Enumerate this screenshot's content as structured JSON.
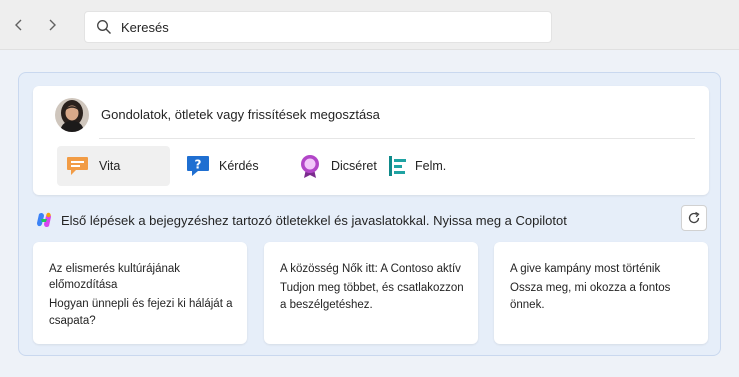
{
  "nav": {
    "back_icon": "chevron-left-icon",
    "forward_icon": "chevron-right-icon"
  },
  "search": {
    "placeholder": "Keresés",
    "icon": "search-icon"
  },
  "composer": {
    "prompt": "Gondolatok, ötletek vagy frissítések megosztása",
    "post_types": [
      {
        "label": "Vita",
        "icon": "discussion-icon",
        "color": "#e8833a"
      },
      {
        "label": "Kérdés",
        "icon": "question-icon",
        "color": "#1f6fd1"
      },
      {
        "label": "Dicséret",
        "icon": "praise-badge-icon",
        "color": "#a43ab8"
      },
      {
        "label": "Felm.",
        "icon": "poll-icon",
        "color": "#0f8a8a"
      }
    ]
  },
  "copilot": {
    "text": "Első lépések a bejegyzéshez tartozó ötletekkel és javaslatokkal. Nyissa meg a Copilotot",
    "refresh_icon": "refresh-icon"
  },
  "suggestions": [
    {
      "title": "Az elismerés kultúrájának előmozdítása",
      "desc": "Hogyan ünnepli és fejezi ki háláját a csapata?"
    },
    {
      "title": "A közösség Nők itt: A Contoso aktív",
      "desc": "Tudjon meg többet, és csatlakozzon a beszélgetéshez."
    },
    {
      "title": "A give kampány most történik",
      "desc": "Ossza meg, mi okozza a fontos önnek."
    }
  ],
  "colors": {
    "accent": "#0f6cbd",
    "feed_background": "#e6eef9"
  }
}
